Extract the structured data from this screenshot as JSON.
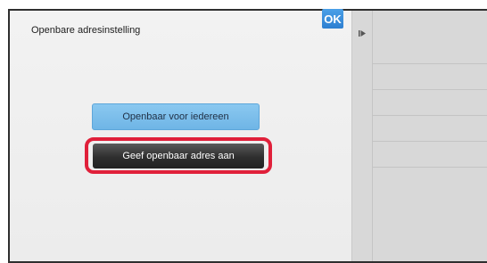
{
  "dialog": {
    "title": "Openbare adresinstelling",
    "ok_label": "OK",
    "options": {
      "public_all": "Openbaar voor iedereen",
      "specify_address": "Geef openbaar adres aan"
    },
    "selected_option": "specify_address",
    "highlight_color": "#e0203a"
  },
  "side_panel": {
    "toggle_icon": "play-triangle-icon"
  }
}
